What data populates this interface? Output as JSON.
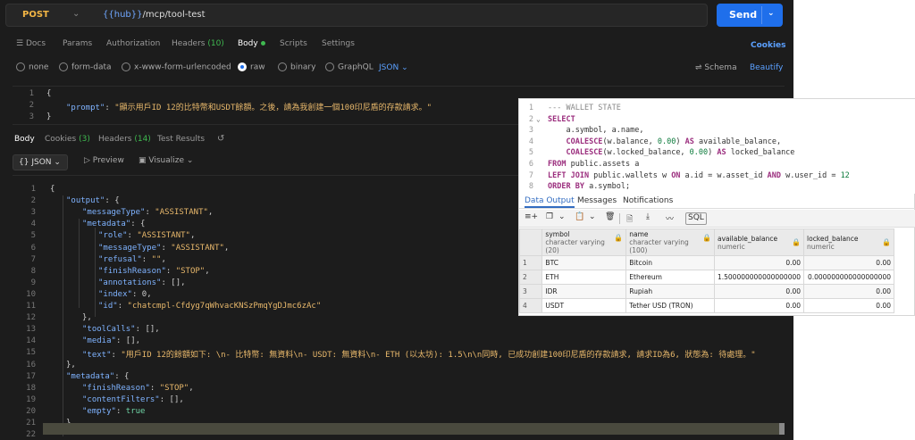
{
  "request": {
    "method": "POST",
    "url_var": "{{hub}}",
    "url_path": "/mcp/tool-test",
    "send_label": "Send"
  },
  "tabs": [
    {
      "label": "Docs"
    },
    {
      "label": "Params"
    },
    {
      "label": "Authorization"
    },
    {
      "label": "Headers",
      "count": "(10)"
    },
    {
      "label": "Body"
    },
    {
      "label": "Scripts"
    },
    {
      "label": "Settings"
    }
  ],
  "cookies_label": "Cookies",
  "body_types": [
    "none",
    "form-data",
    "x-www-form-urlencoded",
    "raw",
    "binary",
    "GraphQL"
  ],
  "body_format": "JSON",
  "schema_label": "Schema",
  "beautify_label": "Beautify",
  "request_body": {
    "lines": [
      "1",
      "2",
      "3"
    ],
    "open": "{",
    "key": "\"prompt\"",
    "value": "\"顯示用戶ID 12的比特幣和USDT餘額。之後，請為我創建一個100印尼盾的存款請求。\"",
    "close": "}"
  },
  "response_tabs": [
    {
      "label": "Body"
    },
    {
      "label": "Cookies",
      "count": "(3)"
    },
    {
      "label": "Headers",
      "count": "(14)"
    },
    {
      "label": "Test Results"
    }
  ],
  "response_toolbar": {
    "format": "JSON",
    "preview": "Preview",
    "visualize": "Visualize"
  },
  "response_lines": [
    {
      "n": "1",
      "indent": 0,
      "text": "{"
    },
    {
      "n": "2",
      "indent": 1,
      "key": "\"output\"",
      "text": ": {"
    },
    {
      "n": "3",
      "indent": 2,
      "key": "\"messageType\"",
      "text": ": ",
      "val": "\"ASSISTANT\"",
      "tail": ","
    },
    {
      "n": "4",
      "indent": 2,
      "key": "\"metadata\"",
      "text": ": {"
    },
    {
      "n": "5",
      "indent": 3,
      "key": "\"role\"",
      "text": ": ",
      "val": "\"ASSISTANT\"",
      "tail": ","
    },
    {
      "n": "6",
      "indent": 3,
      "key": "\"messageType\"",
      "text": ": ",
      "val": "\"ASSISTANT\"",
      "tail": ","
    },
    {
      "n": "7",
      "indent": 3,
      "key": "\"refusal\"",
      "text": ": ",
      "val": "\"\"",
      "tail": ","
    },
    {
      "n": "8",
      "indent": 3,
      "key": "\"finishReason\"",
      "text": ": ",
      "val": "\"STOP\"",
      "tail": ","
    },
    {
      "n": "9",
      "indent": 3,
      "key": "\"annotations\"",
      "text": ": [],"
    },
    {
      "n": "10",
      "indent": 3,
      "key": "\"index\"",
      "text": ": 0,"
    },
    {
      "n": "11",
      "indent": 3,
      "key": "\"id\"",
      "text": ": ",
      "val": "\"chatcmpl-Cfdyg7qWhvacKNSzPmqYgDJmc6zAc\""
    },
    {
      "n": "12",
      "indent": 2,
      "text": "},"
    },
    {
      "n": "13",
      "indent": 2,
      "key": "\"toolCalls\"",
      "text": ": [],"
    },
    {
      "n": "14",
      "indent": 2,
      "key": "\"media\"",
      "text": ": [],"
    },
    {
      "n": "15",
      "indent": 2,
      "key": "\"text\"",
      "text": ": ",
      "val": "\"用戶ID 12的餘額如下: \\n- 比特幣: 無資料\\n- USDT: 無資料\\n- ETH (以太坊): 1.5\\n\\n同時, 已成功創建100印尼盾的存款請求, 請求ID為6, 狀態為: 待處理。\""
    },
    {
      "n": "16",
      "indent": 1,
      "text": "},"
    },
    {
      "n": "17",
      "indent": 1,
      "key": "\"metadata\"",
      "text": ": {"
    },
    {
      "n": "18",
      "indent": 2,
      "key": "\"finishReason\"",
      "text": ": ",
      "val": "\"STOP\"",
      "tail": ","
    },
    {
      "n": "19",
      "indent": 2,
      "key": "\"contentFilters\"",
      "text": ": [],"
    },
    {
      "n": "20",
      "indent": 2,
      "key": "\"empty\"",
      "text": ": ",
      "kw": "true"
    },
    {
      "n": "21",
      "indent": 1,
      "text": "}"
    },
    {
      "n": "22",
      "indent": 0,
      "text": ""
    }
  ],
  "sql": {
    "lines": [
      {
        "n": "1",
        "html": "<span class='pgcm'>--- WALLET STATE</span>"
      },
      {
        "n": "2",
        "html": "<span class='pgkw'>SELECT</span>"
      },
      {
        "n": "3",
        "html": "    a.symbol, a.name,"
      },
      {
        "n": "4",
        "html": "    <span class='pgkw'>COALESCE</span>(w.balance, <span class='pgnum'>0.00</span>) <span class='pgkw'>AS</span> available_balance,"
      },
      {
        "n": "5",
        "html": "    <span class='pgkw'>COALESCE</span>(w.locked_balance, <span class='pgnum'>0.00</span>) <span class='pgkw'>AS</span> locked_balance"
      },
      {
        "n": "6",
        "html": "<span class='pgkw'>FROM</span> public.assets a"
      },
      {
        "n": "7",
        "html": "<span class='pgkw'>LEFT JOIN</span> public.wallets w <span class='pgkw'>ON</span> a.id = w.asset_id <span class='pgkw'>AND</span> w.user_id = <span class='pgnum'>12</span>"
      },
      {
        "n": "8",
        "html": "<span class='pgkw'>ORDER BY</span> a.symbol;"
      }
    ]
  },
  "pg_tabs": [
    "Data Output",
    "Messages",
    "Notifications"
  ],
  "pg_sql_button": "SQL",
  "grid": {
    "columns": [
      {
        "name": "symbol",
        "type": "character varying (20)"
      },
      {
        "name": "name",
        "type": "character varying (100)"
      },
      {
        "name": "available_balance",
        "type": "numeric"
      },
      {
        "name": "locked_balance",
        "type": "numeric"
      }
    ],
    "rows": [
      {
        "n": "1",
        "cells": [
          "BTC",
          "Bitcoin",
          "0.00",
          "0.00"
        ]
      },
      {
        "n": "2",
        "cells": [
          "ETH",
          "Ethereum",
          "1.500000000000000000",
          "0.000000000000000000"
        ]
      },
      {
        "n": "3",
        "cells": [
          "IDR",
          "Rupiah",
          "0.00",
          "0.00"
        ]
      },
      {
        "n": "4",
        "cells": [
          "USDT",
          "Tether USD (TRON)",
          "0.00",
          "0.00"
        ]
      }
    ]
  }
}
